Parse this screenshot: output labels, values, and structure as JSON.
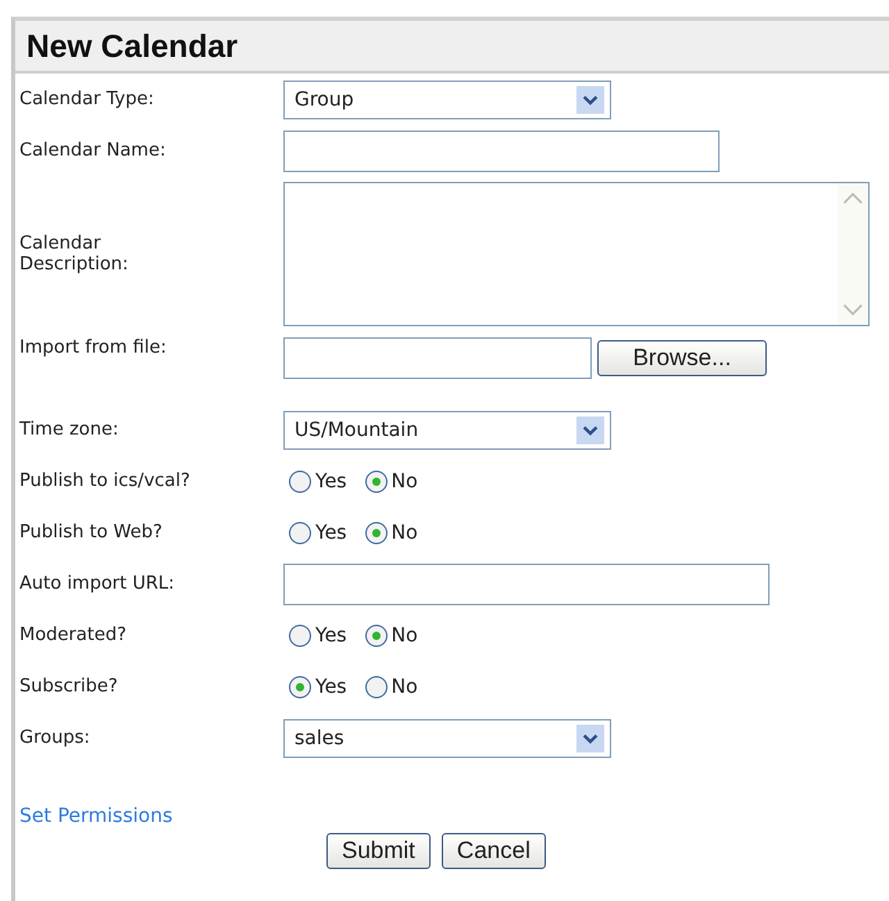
{
  "title": "New Calendar",
  "fields": [
    {
      "kind": "select",
      "label": "Calendar Type:",
      "value": "Group"
    },
    {
      "kind": "text",
      "label": "Calendar Name:"
    },
    {
      "kind": "textarea",
      "label": "Calendar Description:"
    },
    {
      "kind": "file",
      "label": "Import from file:",
      "button": "Browse..."
    },
    {
      "kind": "select",
      "label": "Time zone:",
      "value": "US/Mountain"
    },
    {
      "kind": "radio",
      "label": "Publish to ics/vcal?",
      "options": [
        {
          "label": "Yes",
          "selected": false
        },
        {
          "label": "No",
          "selected": true
        }
      ]
    },
    {
      "kind": "radio",
      "label": "Publish to Web?",
      "options": [
        {
          "label": "Yes",
          "selected": false
        },
        {
          "label": "No",
          "selected": true
        }
      ]
    },
    {
      "kind": "url",
      "label": "Auto import URL:"
    },
    {
      "kind": "radio",
      "label": "Moderated?",
      "options": [
        {
          "label": "Yes",
          "selected": false
        },
        {
          "label": "No",
          "selected": true
        }
      ]
    },
    {
      "kind": "radio",
      "label": "Subscribe?",
      "options": [
        {
          "label": "Yes",
          "selected": true
        },
        {
          "label": "No",
          "selected": false
        }
      ]
    },
    {
      "kind": "select",
      "label": "Groups:",
      "value": "sales"
    }
  ],
  "link": "Set Permissions",
  "buttons": [
    "Submit",
    "Cancel"
  ]
}
